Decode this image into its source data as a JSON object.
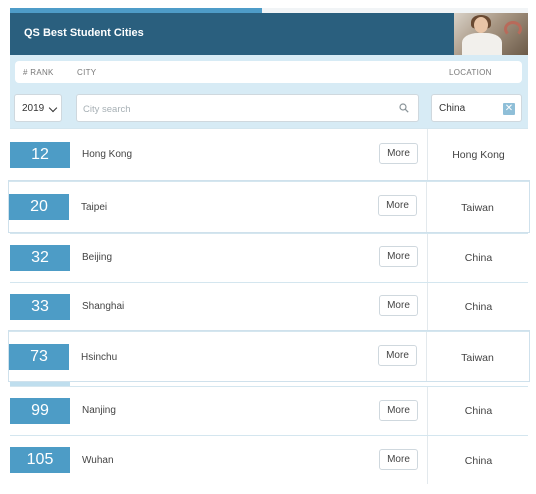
{
  "title": "QS Best Student Cities",
  "columns": {
    "rank": "# RANK",
    "city": "CITY",
    "location": "LOCATION"
  },
  "filters": {
    "year": "2019",
    "search_placeholder": "City search",
    "location_value": "China",
    "clear_symbol": "✕"
  },
  "more_label": "More",
  "rows": [
    {
      "rank": "12",
      "city": "Hong Kong",
      "location": "Hong Kong"
    },
    {
      "rank": "20",
      "city": "Taipei",
      "location": "Taiwan"
    },
    {
      "rank": "32",
      "city": "Beijing",
      "location": "China"
    },
    {
      "rank": "33",
      "city": "Shanghai",
      "location": "China"
    },
    {
      "rank": "73",
      "city": "Hsinchu",
      "location": "Taiwan"
    },
    {
      "rank": "99",
      "city": "Nanjing",
      "location": "China"
    },
    {
      "rank": "105",
      "city": "Wuhan",
      "location": "China"
    }
  ],
  "colors": {
    "header": "#2a5f7e",
    "rank_badge": "#4d9cc6",
    "band": "#bfdeee"
  }
}
